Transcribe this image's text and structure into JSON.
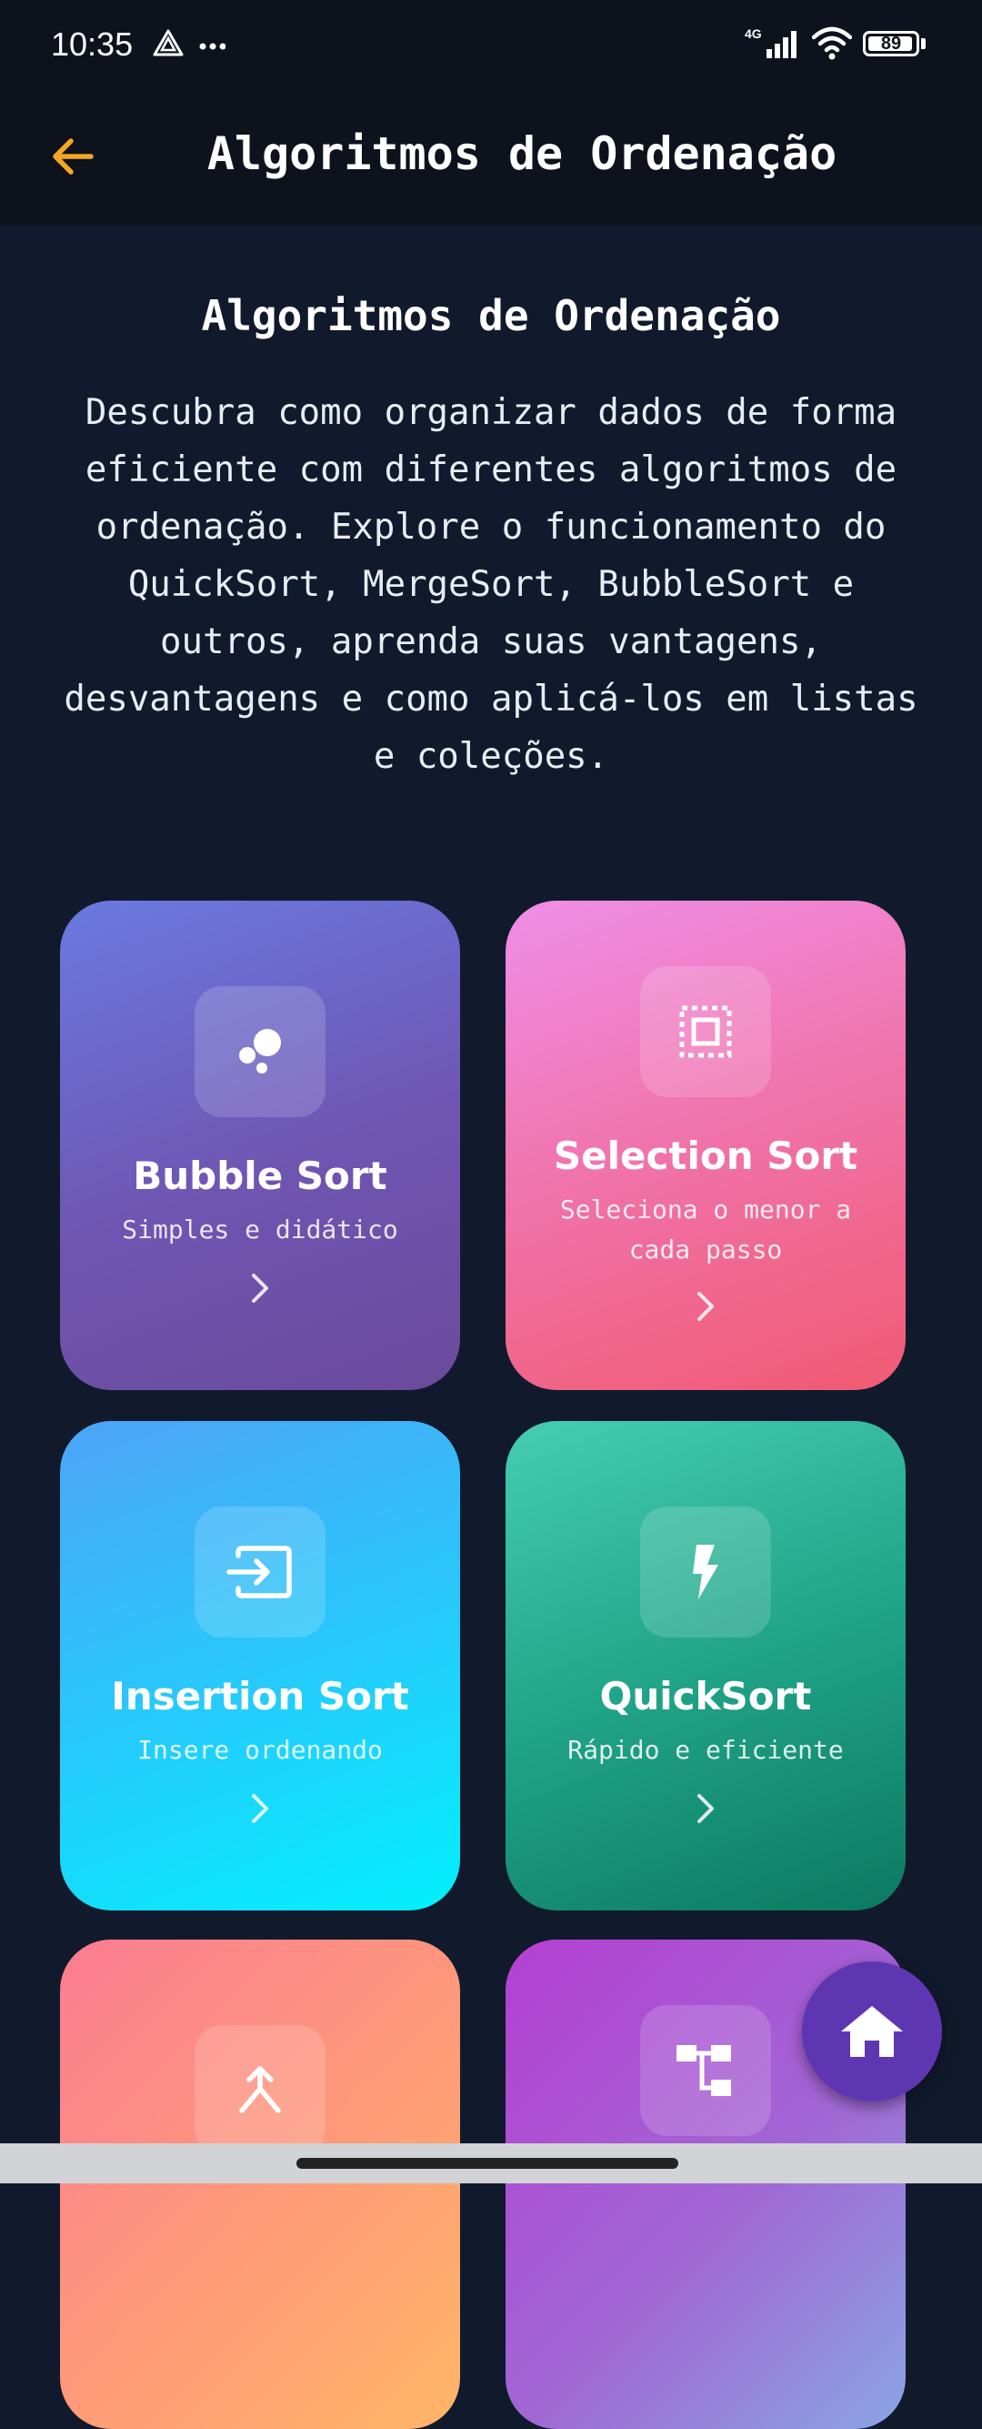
{
  "status_bar": {
    "time": "10:35",
    "network": "4G",
    "battery_level": "89",
    "icons": [
      "alert-triangle-icon",
      "more-dots-icon",
      "signal-icon",
      "wifi-icon",
      "battery-icon"
    ]
  },
  "app_bar": {
    "title": "Algoritmos de Ordenação",
    "back_icon": "arrow-left-icon",
    "accent_color": "#f5a623"
  },
  "intro": {
    "title": "Algoritmos de Ordenação",
    "text": "Descubra como organizar dados de forma eficiente com diferentes algoritmos de ordenação. Explore o funcionamento do QuickSort, MergeSort, BubbleSort e outros, aprenda suas vantagens, desvantagens e como aplicá-los em listas e coleções."
  },
  "cards": [
    {
      "title": "Bubble Sort",
      "subtitle": "Simples e didático",
      "icon": "bubbles-icon",
      "colors": [
        "#6a7ae0",
        "#6b4a9c"
      ]
    },
    {
      "title": "Selection Sort",
      "subtitle": "Seleciona o menor a cada passo",
      "icon": "selection-icon",
      "colors": [
        "#ef8ee8",
        "#f15a72"
      ]
    },
    {
      "title": "Insertion Sort",
      "subtitle": "Insere ordenando",
      "icon": "input-icon",
      "colors": [
        "#4ea4f7",
        "#02f0fd"
      ]
    },
    {
      "title": "QuickSort",
      "subtitle": "Rápido e eficiente",
      "icon": "lightning-icon",
      "colors": [
        "#46cdb3",
        "#0b7a61"
      ]
    },
    {
      "title": "",
      "subtitle": "",
      "icon": "merge-icon",
      "colors": [
        "#fc7c92",
        "#ffb667"
      ]
    },
    {
      "title": "",
      "subtitle": "",
      "icon": "tree-icon",
      "colors": [
        "#b53fd2",
        "#8aa5e4"
      ]
    }
  ],
  "fab": {
    "icon": "home-icon",
    "color": "#5f36b2"
  }
}
